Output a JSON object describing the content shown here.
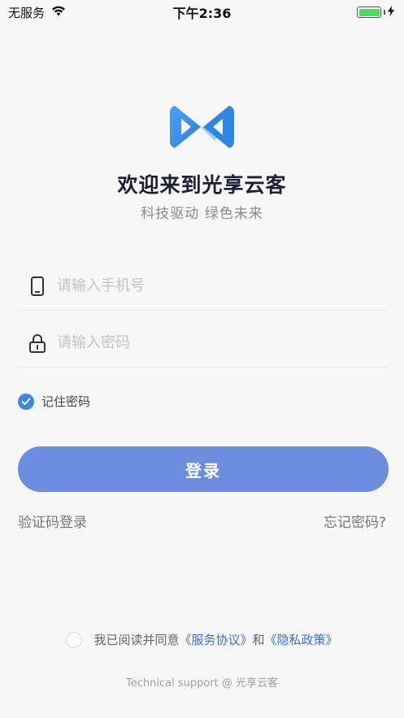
{
  "status_bar": {
    "carrier": "无服务",
    "time": "下午2:36",
    "icons": [
      "wifi-icon",
      "battery-icon",
      "charging-icon"
    ],
    "battery_color": "#4cd964"
  },
  "brand": {
    "logo_icon": "bowtie-logo-icon",
    "logo_color": "#3a8fe8",
    "title": "欢迎来到光享云客",
    "subtitle": "科技驱动 绿色未来"
  },
  "form": {
    "phone": {
      "icon": "phone-icon",
      "placeholder": "请输入手机号",
      "value": ""
    },
    "password": {
      "icon": "lock-icon",
      "placeholder": "请输入密码",
      "value": ""
    },
    "remember": {
      "label": "记住密码",
      "checked": true,
      "color": "#3b86e6"
    },
    "login_label": "登录",
    "login_color": "#6a8de0"
  },
  "links": {
    "sms_login": "验证码登录",
    "forgot_password": "忘记密码?"
  },
  "agreement": {
    "prefix": "我已阅读并同意",
    "service_link": "《服务协议》",
    "conjunction": "和",
    "privacy_link": "《隐私政策》",
    "checked": false
  },
  "footer": {
    "support": "Technical support @ 光享云客"
  }
}
